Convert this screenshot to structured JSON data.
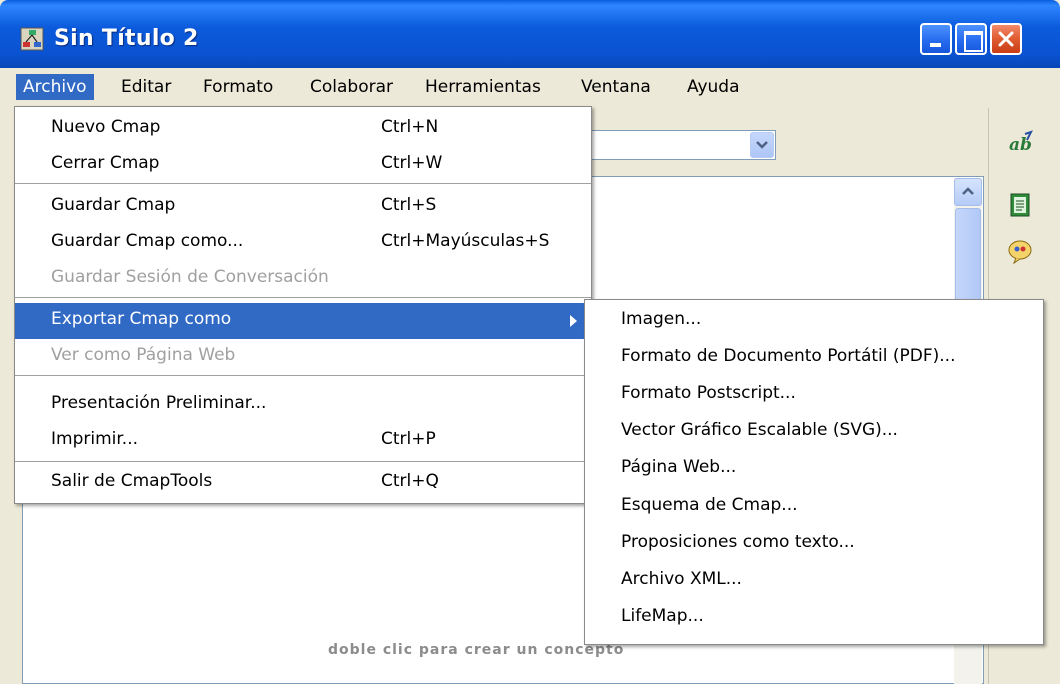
{
  "window": {
    "title": "Sin Título 2"
  },
  "menubar": {
    "items": [
      "Archivo",
      "Editar",
      "Formato",
      "Colaborar",
      "Herramientas",
      "Ventana",
      "Ayuda"
    ]
  },
  "file_menu": {
    "nuevo": {
      "label": "Nuevo Cmap",
      "shortcut": "Ctrl+N"
    },
    "cerrar": {
      "label": "Cerrar Cmap",
      "shortcut": "Ctrl+W"
    },
    "guardar": {
      "label": "Guardar Cmap",
      "shortcut": "Ctrl+S"
    },
    "guardar_como": {
      "label": "Guardar Cmap como...",
      "shortcut": "Ctrl+Mayúsculas+S"
    },
    "guardar_sesion": {
      "label": "Guardar Sesión de Conversación",
      "disabled": true
    },
    "exportar": {
      "label": "Exportar Cmap como",
      "highlighted": true
    },
    "ver_web": {
      "label": "Ver como Página Web",
      "disabled": true
    },
    "presentacion": {
      "label": "Presentación Preliminar..."
    },
    "imprimir": {
      "label": "Imprimir...",
      "shortcut": "Ctrl+P"
    },
    "salir": {
      "label": "Salir de CmapTools",
      "shortcut": "Ctrl+Q"
    }
  },
  "export_submenu": {
    "items": [
      "Imagen...",
      "Formato de Documento Portátil (PDF)...",
      "Formato Postscript...",
      "Vector Gráfico Escalable (SVG)...",
      "Página Web...",
      "Esquema de Cmap...",
      "Proposiciones como texto...",
      "Archivo XML...",
      "LifeMap..."
    ]
  },
  "canvas": {
    "hint": "doble clic para crear un concepto"
  },
  "colors": {
    "titlebar": "#0a52d1",
    "menu_highlight": "#316ac5",
    "close_button": "#e05b30"
  },
  "icons": [
    "app-icon",
    "minimize-icon",
    "maximize-icon",
    "close-icon",
    "chevron-down-icon",
    "scroll-up-icon",
    "styles-icon",
    "notes-icon",
    "chat-icon",
    "submenu-arrow-icon"
  ]
}
